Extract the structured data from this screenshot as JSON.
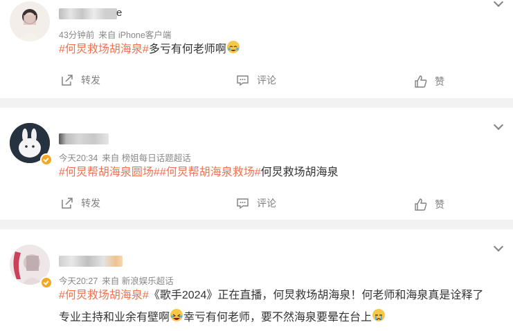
{
  "posts": [
    {
      "name": "e",
      "time": "43分钟前",
      "source": "来自 iPhone客户端",
      "content": {
        "tags": [
          "#何炅救场胡海泉#"
        ],
        "text": "多亏有何老师啊",
        "emoji": "laughing-tears-emoji"
      },
      "actions": {
        "repost": "转发",
        "comment": "评论",
        "like": "赞"
      }
    },
    {
      "name": "",
      "time": "今天20:34",
      "source": "来自 榜姐每日话题超话",
      "content": {
        "tags": [
          "#何炅帮胡海泉圆场#",
          "#何炅帮胡海泉救场#"
        ],
        "text": "何炅救场胡海泉"
      },
      "actions": {
        "repost": "转发",
        "comment": "评论",
        "like": "赞"
      }
    },
    {
      "name": "",
      "time": "今天20:27",
      "source": "来自 新浪娱乐超话",
      "content": {
        "tags": [
          "#何炅救场胡海泉#"
        ],
        "line1": "《歌手2024》正在直播，何炅救场胡海泉！何老师和海泉真是诠释了",
        "line2a": "专业主持和业余有壁啊",
        "line2b": "幸亏有何老师，要不然海泉要晕在台上",
        "emoji1": "laughing-crying-emoji",
        "emoji2": "crying-emoji"
      }
    }
  ],
  "colors": {
    "tag": "#eb7350",
    "meta": "#888888",
    "badge": "#f5a623",
    "separator": "#f2f2f2"
  }
}
